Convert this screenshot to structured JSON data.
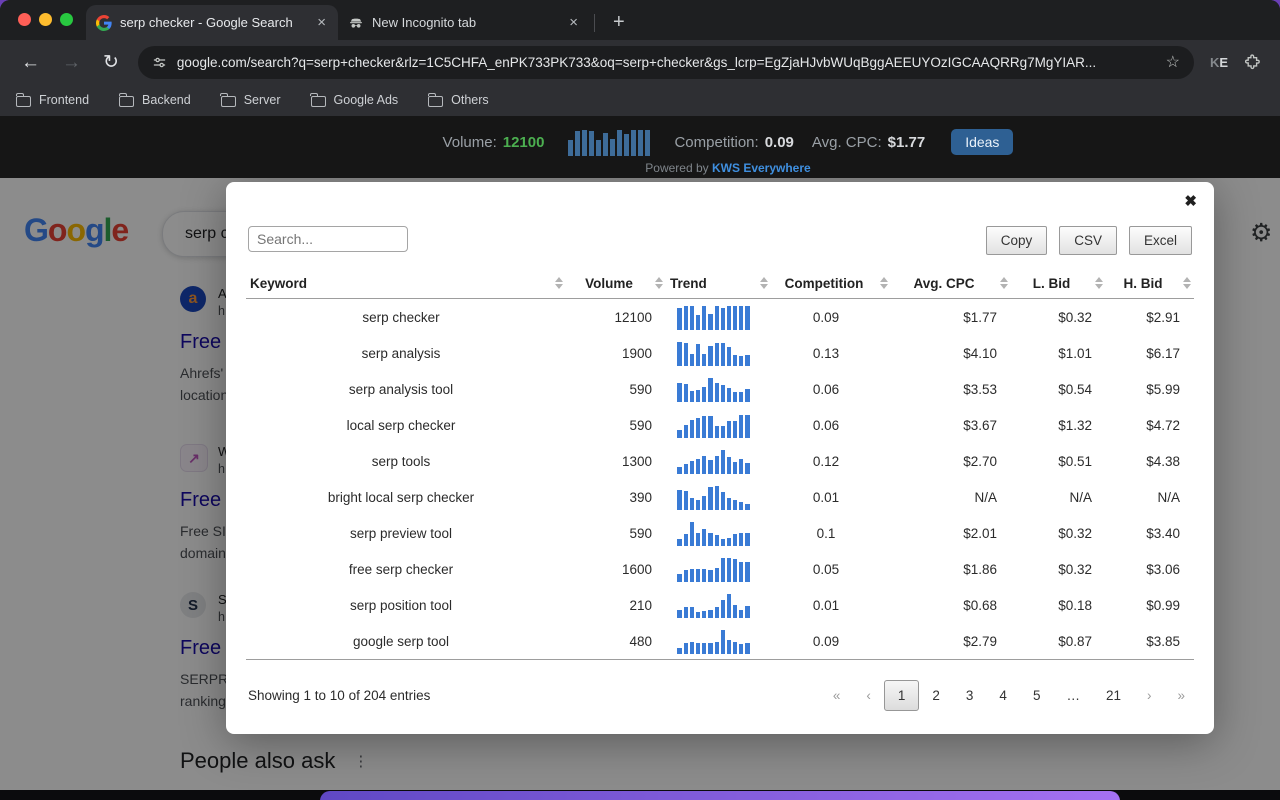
{
  "icons": {
    "back": "←",
    "forward": "→",
    "reload": "↻",
    "star": "☆",
    "tab_close": "×",
    "new_tab": "+",
    "modal_close": "✖",
    "gear": "⚙",
    "kebab": "⋮"
  },
  "window": {
    "tabs": [
      {
        "title": "serp checker - Google Search"
      },
      {
        "title": "New Incognito tab"
      }
    ],
    "toolbar": {
      "url": "google.com/search?q=serp+checker&rlz=1C5CHFA_enPK733PK733&oq=serp+checker&gs_lcrp=EgZjaHJvbWUqBggAEEUYOzIGCAAQRRg7MgYIAR...",
      "extension_badge": "KE"
    },
    "bookmarks": [
      "Frontend",
      "Backend",
      "Server",
      "Google Ads",
      "Others"
    ]
  },
  "kws_bar": {
    "volume_label": "Volume:",
    "volume_value": "12100",
    "trend": [
      0.6,
      0.95,
      1,
      0.95,
      0.6,
      0.9,
      0.65,
      1,
      0.85,
      1,
      1,
      1
    ],
    "competition_label": "Competition:",
    "competition_value": "0.09",
    "avg_cpc_label": "Avg. CPC:",
    "avg_cpc_value": "$1.77",
    "ideas_button": "Ideas",
    "powered_by": "Powered by ",
    "brand_link": "KWS Everywhere"
  },
  "google_page": {
    "search_box_text": "serp c",
    "logo_letters": [
      {
        "ch": "G",
        "color": "#4285F4"
      },
      {
        "ch": "o",
        "color": "#EA4335"
      },
      {
        "ch": "o",
        "color": "#FBBC05"
      },
      {
        "ch": "g",
        "color": "#4285F4"
      },
      {
        "ch": "l",
        "color": "#34A853"
      },
      {
        "ch": "e",
        "color": "#EA4335"
      }
    ],
    "results": [
      {
        "favicon_letter": "a",
        "site_fragment": "A",
        "url_fragment": "h",
        "heading_fragment": "Free",
        "snippet_line1": "Ahrefs'",
        "snippet_line2": "location"
      },
      {
        "favicon_letter": "↗",
        "site_fragment": "W",
        "url_fragment": "h",
        "heading_fragment": "Free",
        "snippet_line1": "Free SI",
        "snippet_line2": "domain"
      },
      {
        "favicon_letter": "S",
        "site_fragment": "S",
        "url_fragment": "h",
        "heading_fragment": "Free",
        "snippet_line1": "SERPR",
        "snippet_line2": "ranking"
      }
    ],
    "people_also_ask": "People also ask"
  },
  "modal": {
    "search_placeholder": "Search...",
    "export_buttons": [
      "Copy",
      "CSV",
      "Excel"
    ],
    "footer_status": "Showing 1 to 10 of 204 entries",
    "pagination": [
      {
        "label": "«",
        "type": "nav"
      },
      {
        "label": "‹",
        "type": "nav"
      },
      {
        "label": "1",
        "type": "active"
      },
      {
        "label": "2",
        "type": "page"
      },
      {
        "label": "3",
        "type": "page"
      },
      {
        "label": "4",
        "type": "page"
      },
      {
        "label": "5",
        "type": "page"
      },
      {
        "label": "…",
        "type": "page"
      },
      {
        "label": "21",
        "type": "page"
      },
      {
        "label": "›",
        "type": "nav"
      },
      {
        "label": "»",
        "type": "nav"
      }
    ],
    "trend_bar_color": "#3a7bd5"
  },
  "chart_data": {
    "type": "table",
    "title": "Keywords Everywhere keyword metrics",
    "columns": [
      "Keyword",
      "Volume",
      "Trend",
      "Competition",
      "Avg. CPC",
      "L. Bid",
      "H. Bid"
    ],
    "rows": [
      {
        "keyword": "serp checker",
        "volume": "12100",
        "competition": "0.09",
        "avg_cpc": "$1.77",
        "l_bid": "$0.32",
        "h_bid": "$2.91",
        "trend": [
          0.9,
          1,
          1,
          0.62,
          1,
          0.66,
          1,
          0.92,
          1,
          1,
          1,
          1
        ]
      },
      {
        "keyword": "serp analysis",
        "volume": "1900",
        "competition": "0.13",
        "avg_cpc": "$4.10",
        "l_bid": "$1.01",
        "h_bid": "$6.17",
        "trend": [
          1,
          0.95,
          0.52,
          0.9,
          0.52,
          0.85,
          0.95,
          0.95,
          0.8,
          0.45,
          0.42,
          0.45
        ]
      },
      {
        "keyword": "serp analysis tool",
        "volume": "590",
        "competition": "0.06",
        "avg_cpc": "$3.53",
        "l_bid": "$0.54",
        "h_bid": "$5.99",
        "trend": [
          0.8,
          0.75,
          0.45,
          0.5,
          0.62,
          1,
          0.78,
          0.72,
          0.6,
          0.42,
          0.42,
          0.55
        ]
      },
      {
        "keyword": "local serp checker",
        "volume": "590",
        "competition": "0.06",
        "avg_cpc": "$3.67",
        "l_bid": "$1.32",
        "h_bid": "$4.72",
        "trend": [
          0.35,
          0.55,
          0.75,
          0.82,
          0.9,
          0.9,
          0.52,
          0.48,
          0.7,
          0.72,
          0.95,
          0.95
        ]
      },
      {
        "keyword": "serp tools",
        "volume": "1300",
        "competition": "0.12",
        "avg_cpc": "$2.70",
        "l_bid": "$0.51",
        "h_bid": "$4.38",
        "trend": [
          0.3,
          0.42,
          0.55,
          0.62,
          0.75,
          0.6,
          0.75,
          1,
          0.72,
          0.5,
          0.62,
          0.45
        ]
      },
      {
        "keyword": "bright local serp checker",
        "volume": "390",
        "competition": "0.01",
        "avg_cpc": "N/A",
        "l_bid": "N/A",
        "h_bid": "N/A",
        "trend": [
          0.85,
          0.8,
          0.48,
          0.42,
          0.58,
          0.95,
          1,
          0.75,
          0.5,
          0.4,
          0.35,
          0.25
        ]
      },
      {
        "keyword": "serp preview tool",
        "volume": "590",
        "competition": "0.1",
        "avg_cpc": "$2.01",
        "l_bid": "$0.32",
        "h_bid": "$3.40",
        "trend": [
          0.3,
          0.52,
          1,
          0.55,
          0.7,
          0.55,
          0.45,
          0.3,
          0.35,
          0.5,
          0.55,
          0.55
        ]
      },
      {
        "keyword": "free serp checker",
        "volume": "1600",
        "competition": "0.05",
        "avg_cpc": "$1.86",
        "l_bid": "$0.32",
        "h_bid": "$3.06",
        "trend": [
          0.35,
          0.5,
          0.55,
          0.55,
          0.55,
          0.5,
          0.6,
          1,
          1,
          0.95,
          0.85,
          0.85
        ]
      },
      {
        "keyword": "serp position tool",
        "volume": "210",
        "competition": "0.01",
        "avg_cpc": "$0.68",
        "l_bid": "$0.18",
        "h_bid": "$0.99",
        "trend": [
          0.35,
          0.45,
          0.45,
          0.25,
          0.3,
          0.35,
          0.45,
          0.75,
          1,
          0.55,
          0.35,
          0.5
        ]
      },
      {
        "keyword": "google serp tool",
        "volume": "480",
        "competition": "0.09",
        "avg_cpc": "$2.79",
        "l_bid": "$0.87",
        "h_bid": "$3.85",
        "trend": [
          0.25,
          0.45,
          0.52,
          0.45,
          0.45,
          0.45,
          0.5,
          1,
          0.6,
          0.5,
          0.4,
          0.45
        ]
      }
    ]
  }
}
